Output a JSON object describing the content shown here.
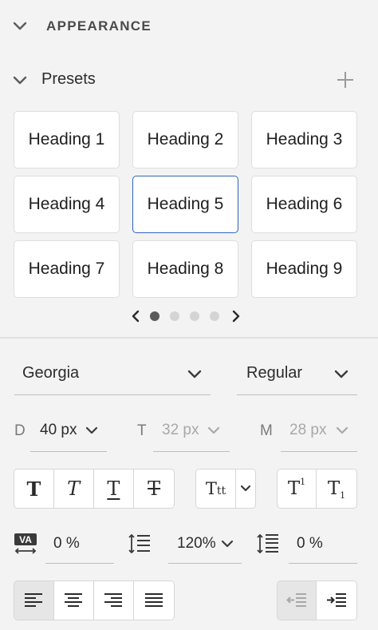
{
  "section": {
    "title": "APPEARANCE",
    "collapse_icon": "chevron-down-icon"
  },
  "presets": {
    "label": "Presets",
    "add_icon": "plus-icon",
    "items": [
      "Heading 1",
      "Heading 2",
      "Heading 3",
      "Heading 4",
      "Heading 5",
      "Heading 6",
      "Heading 7",
      "Heading 8",
      "Heading 9"
    ],
    "selected_index": 4,
    "page_count": 4,
    "current_page": 1
  },
  "font": {
    "family": "Georgia",
    "style": "Regular"
  },
  "sizes": {
    "desktop_prefix": "D",
    "desktop_value": "40 px",
    "tablet_prefix": "T",
    "tablet_value": "32 px",
    "mobile_prefix": "M",
    "mobile_value": "28 px"
  },
  "spacing": {
    "letter_spacing": "0 %",
    "line_height": "120%",
    "paragraph_spacing": "0 %"
  },
  "colors": {
    "accent": "#2d63b8",
    "background": "#f3f3f3",
    "card": "#ffffff"
  }
}
